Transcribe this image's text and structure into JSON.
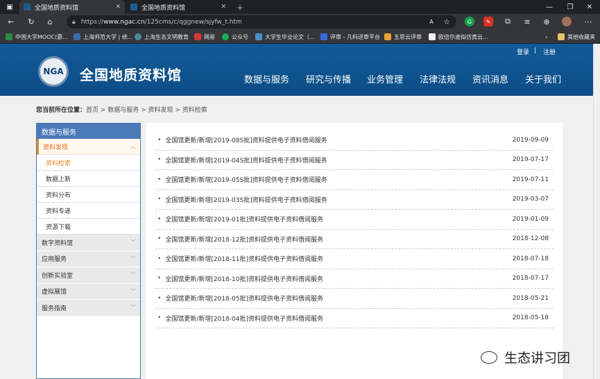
{
  "browser": {
    "tabs": [
      {
        "title": "全国地质资料馆"
      },
      {
        "title": "全国地质资料馆"
      }
    ],
    "url_prefix": "https://",
    "url_host": "www.ngac.cn",
    "url_path": "/125cms/c/qggnew/sjyfw_t.htm",
    "bookmarks": [
      "中国大学MOOC(慕...",
      "上海师范大学 | 统...",
      "上海生态文明教育",
      "网易",
      "公众号",
      "大学生毕业论文（...",
      "评审 - 凡科送审平台",
      "五思云评审",
      "欧倍尔虚拟仿真云..."
    ],
    "other_bookmarks": "其他收藏夹"
  },
  "site": {
    "logo_text": "NGA",
    "name": "全国地质资料馆",
    "login": "登录",
    "sep": "|",
    "register": "注册",
    "nav": [
      "数据与服务",
      "研究与传播",
      "业务管理",
      "法律法规",
      "资讯消息",
      "关于我们"
    ]
  },
  "breadcrumb": {
    "label": "您当前所在位置：",
    "path": "首页 > 数据与服务 > 资料发现 > 资料检索"
  },
  "sidebar": {
    "title": "数据与服务",
    "open_section": "资料发现",
    "sub_items": [
      "资料检索",
      "数据上新",
      "资料分布",
      "资料专递",
      "资源下载"
    ],
    "categories": [
      "数字资料馆",
      "应用服务",
      "创新实验室",
      "虚拟展馆",
      "服务指南"
    ]
  },
  "news": [
    {
      "title": "全国馆更新/新增[2019-08S批]资料提供电子资料借阅服务",
      "date": "2019-09-09"
    },
    {
      "title": "全国馆更新/新增[2019-04S批]资料提供电子资料借阅服务",
      "date": "2019-07-17"
    },
    {
      "title": "全国馆更新/新增[2019-05S批]资料提供电子资料借阅服务",
      "date": "2019-07-11"
    },
    {
      "title": "全国馆更新/新增[2019-03S批]资料提供电子资料借阅服务",
      "date": "2019-03-07"
    },
    {
      "title": "全国馆更新/新增[2019-01批]资料提供电子资料借阅服务",
      "date": "2019-01-09"
    },
    {
      "title": "全国馆更新/新增[2018-12批]资料提供电子资料借阅服务",
      "date": "2018-12-08"
    },
    {
      "title": "全国馆更新/新增[2018-11批]资料提供电子资料借阅服务",
      "date": "2018-07-18"
    },
    {
      "title": "全国馆更新/新增[2018-10批]资料提供电子资料借阅服务",
      "date": "2018-07-17"
    },
    {
      "title": "全国馆更新/新增[2018-05批]资料提供电子资料借阅服务",
      "date": "2018-05-21"
    },
    {
      "title": "全国馆更新/新增[2018-04批]资料提供电子资料借阅服务",
      "date": "2018-05-18"
    }
  ],
  "watermark": "生态讲习团",
  "colors": {
    "header": "#115a98",
    "accent": "#e48a2a",
    "sidebar_head": "#4a7ab8"
  }
}
